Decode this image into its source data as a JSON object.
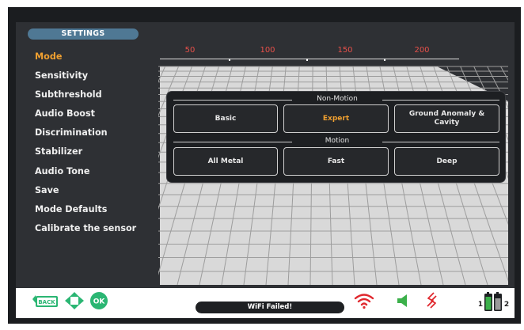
{
  "header": {
    "title": "SETTINGS"
  },
  "menu": {
    "items": [
      {
        "label": "Mode",
        "active": true
      },
      {
        "label": "Sensitivity",
        "active": false
      },
      {
        "label": "Subthreshold",
        "active": false
      },
      {
        "label": "Audio Boost",
        "active": false
      },
      {
        "label": "Discrimination",
        "active": false
      },
      {
        "label": "Stabilizer",
        "active": false
      },
      {
        "label": "Audio Tone",
        "active": false
      },
      {
        "label": "Save",
        "active": false
      },
      {
        "label": "Mode Defaults",
        "active": false
      },
      {
        "label": "Calibrate the sensor",
        "active": false
      }
    ]
  },
  "scale": {
    "ticks": [
      "50",
      "100",
      "150",
      "200"
    ]
  },
  "mode_popup": {
    "non_motion_label": "Non-Motion",
    "motion_label": "Motion",
    "non_motion_options": [
      "Basic",
      "Expert",
      "Ground Anomaly & Cavity"
    ],
    "motion_options": [
      "All Metal",
      "Fast",
      "Deep"
    ],
    "selected": "Expert"
  },
  "footer": {
    "back_label": "BACK",
    "ok_label": "OK",
    "status": "WiFi Failed!",
    "battery_1_label": "1",
    "battery_2_label": "2"
  },
  "icons": {
    "back": "back-arrow-icon",
    "nav": "dpad-icon",
    "ok": "ok-icon",
    "wifi": "wifi-icon",
    "speaker": "speaker-icon",
    "vibration": "vibration-icon",
    "battery": "battery-icon"
  },
  "colors": {
    "accent": "#f0a030",
    "scale_tick": "#e8504a",
    "nav_green": "#2bb673",
    "wifi_red": "#e0282e",
    "speaker_green": "#3bb04a",
    "title_pill": "#4f7894"
  }
}
